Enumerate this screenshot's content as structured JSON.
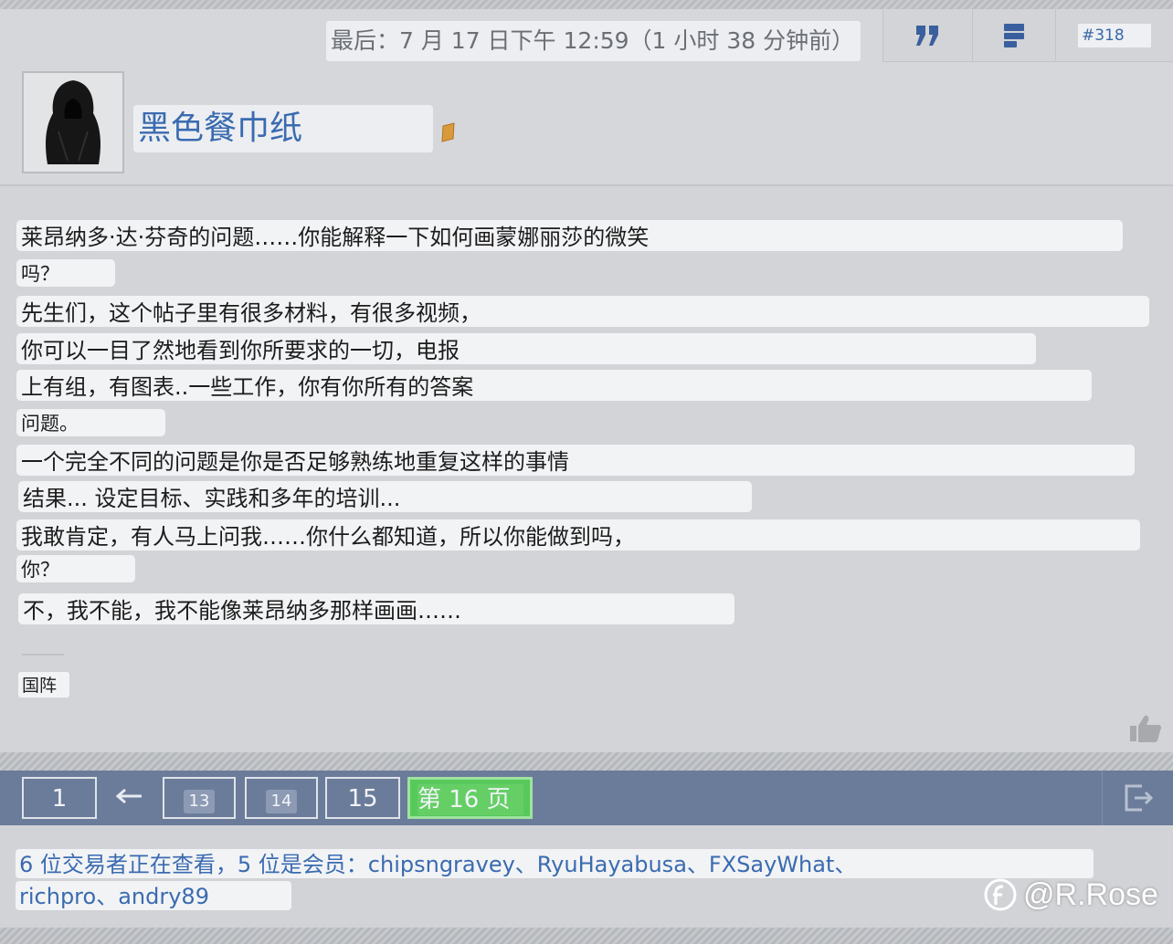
{
  "post": {
    "timestamp": "最后：7 月 17 日下午 12:59（1 小时 38 分钟前）",
    "number": "#318",
    "username": "黑色餐巾纸",
    "lines": [
      "莱昂纳多·达·芬奇的问题……你能解释一下如何画蒙娜丽莎的微笑",
      "吗？",
      "先生们，这个帖子里有很多材料，有很多视频，",
      "你可以一目了然地看到你所要求的一切，电报",
      "上有组，有图表..一些工作，你有你所有的答案",
      "问题。",
      "一个完全不同的问题是你是否足够熟练地重复这样的事情",
      "结果... 设定目标、实践和多年的培训...",
      "我敢肯定，有人马上问我……你什么都知道，所以你能做到吗，",
      "你？",
      "不，我不能，我不能像莱昂纳多那样画画……"
    ],
    "signature_tag": "国阵"
  },
  "pager": {
    "first": "1",
    "pages": [
      "13",
      "14",
      "15"
    ],
    "current": "第 16 页"
  },
  "viewers": {
    "line1": "6 位交易者正在查看，5 位是会员：chipsngravey、RyuHayabusa、FXSayWhat、",
    "line2": "richpro、andry89"
  },
  "watermark": "@R.Rose",
  "icons": {
    "quote": "quote-icon",
    "multi_quote": "multi-quote-icon",
    "flag": "user-flag-icon",
    "like": "thumbs-up-icon",
    "prev": "arrow-left-icon",
    "exit": "exit-icon",
    "weibo": "weibo-logo-icon"
  },
  "colors": {
    "link": "#3a6bb0",
    "pager_bg": "#6b7c9a",
    "current_page": "#57c95a",
    "body_bg": "#d3d4d7"
  }
}
